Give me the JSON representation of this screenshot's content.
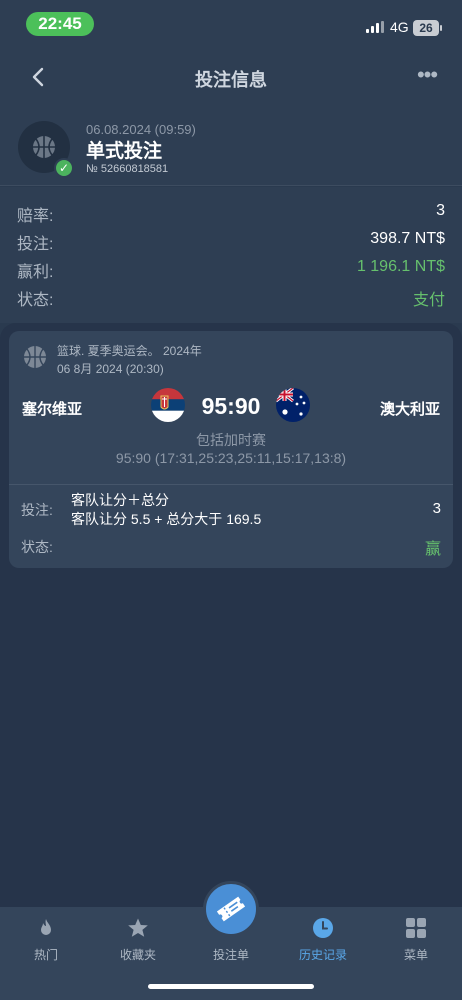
{
  "status_bar": {
    "time": "22:45",
    "network": "4G",
    "battery": "26"
  },
  "nav": {
    "title": "投注信息",
    "more": "•••"
  },
  "bet": {
    "date": "06.08.2024 (09:59)",
    "type": "单式投注",
    "id": "№ 52660818581"
  },
  "summary": [
    {
      "label": "赔率:",
      "value": "3"
    },
    {
      "label": "投注:",
      "value": "398.7 NT$"
    },
    {
      "label": "赢利:",
      "value": "1 196.1 NT$"
    },
    {
      "label": "状态:",
      "value": "支付"
    }
  ],
  "event": {
    "league_line1": "篮球. 夏季奥运会。 2024年",
    "league_line2": "06 8月 2024 (20:30)",
    "home_team": "塞尔维亚",
    "away_team": "澳大利亚",
    "score": "95:90",
    "score_note": "包括加时赛",
    "score_detail": "95:90 (17:31,25:23,25:11,15:17,13:8)",
    "pick_label": "投注:",
    "pick_market": "客队让分＋总分",
    "pick_outcome": "客队让分 5.5 + 总分大于 169.5",
    "pick_odds": "3",
    "state_label": "状态:",
    "state_value": "赢"
  },
  "tabs": [
    {
      "label": "热门",
      "icon": "fire-icon"
    },
    {
      "label": "收藏夹",
      "icon": "star-icon"
    },
    {
      "label": "投注单",
      "icon": "ticket-icon"
    },
    {
      "label": "历史记录",
      "icon": "clock-icon",
      "active": true
    },
    {
      "label": "菜单",
      "icon": "grid-icon"
    }
  ],
  "colors": {
    "accent": "#5aa7e8",
    "win": "#66c06d",
    "background": "#2a3a4f"
  }
}
